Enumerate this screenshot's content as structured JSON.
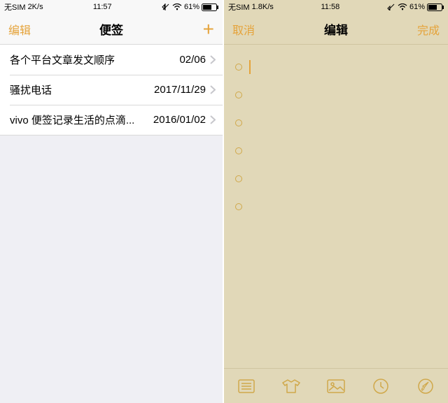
{
  "left": {
    "status": {
      "carrier": "无SIM",
      "netspeed": "2K/s",
      "time": "11:57",
      "battery": "61%"
    },
    "nav": {
      "left": "编辑",
      "title": "便签",
      "right_icon": "plus"
    },
    "notes": [
      {
        "title": "各个平台文章发文顺序",
        "date": "02/06"
      },
      {
        "title": "骚扰电话",
        "date": "2017/11/29"
      },
      {
        "title": "vivo 便签记录生活的点滴...",
        "date": "2016/01/02"
      }
    ]
  },
  "right": {
    "status": {
      "carrier": "无SIM",
      "netspeed": "1.8K/s",
      "time": "11:58",
      "battery": "61%"
    },
    "nav": {
      "left": "取消",
      "title": "编辑",
      "right": "完成"
    },
    "bullet_count": 6,
    "toolbar": [
      "list",
      "shirt",
      "image",
      "clock",
      "brush"
    ]
  }
}
